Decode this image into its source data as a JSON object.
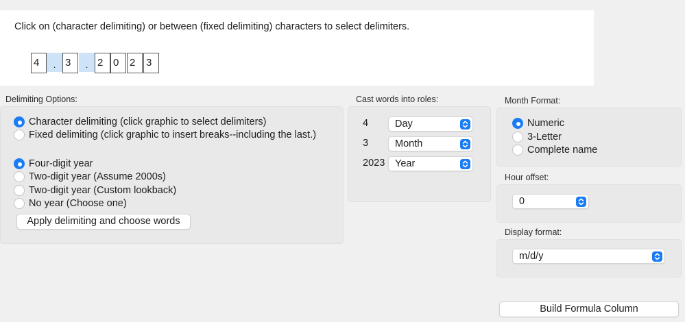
{
  "instruction": "Click on (character delimiting) or between (fixed delimiting) characters to select delimiters.",
  "characters": [
    "4",
    ".",
    "3",
    ".",
    "2",
    "0",
    "2",
    "3"
  ],
  "delimiting": {
    "label": "Delimiting Options:",
    "modes": [
      {
        "label": "Character delimiting (click graphic to select delimiters)",
        "checked": true
      },
      {
        "label": "Fixed delimiting (click graphic to insert breaks--including the last.)",
        "checked": false
      }
    ],
    "years": [
      {
        "label": "Four-digit year",
        "checked": true
      },
      {
        "label": "Two-digit year (Assume 2000s)",
        "checked": false
      },
      {
        "label": "Two-digit year (Custom lookback)",
        "checked": false
      },
      {
        "label": "No year (Choose one)",
        "checked": false
      }
    ],
    "apply_label": "Apply delimiting and choose words"
  },
  "roles": {
    "label": "Cast words into roles:",
    "rows": [
      {
        "word": "4",
        "role": "Day"
      },
      {
        "word": "3",
        "role": "Month"
      },
      {
        "word": "2023",
        "role": "Year"
      }
    ]
  },
  "month_format": {
    "label": "Month Format:",
    "options": [
      {
        "label": "Numeric",
        "checked": true
      },
      {
        "label": "3-Letter",
        "checked": false
      },
      {
        "label": "Complete name",
        "checked": false
      }
    ]
  },
  "hour_offset": {
    "label": "Hour offset:",
    "value": "0"
  },
  "display_format": {
    "label": "Display format:",
    "value": "m/d/y"
  },
  "build_label": "Build Formula Column",
  "colors": {
    "accent": "#1a7cf5",
    "delimiter_highlight": "#cfe3f8"
  }
}
